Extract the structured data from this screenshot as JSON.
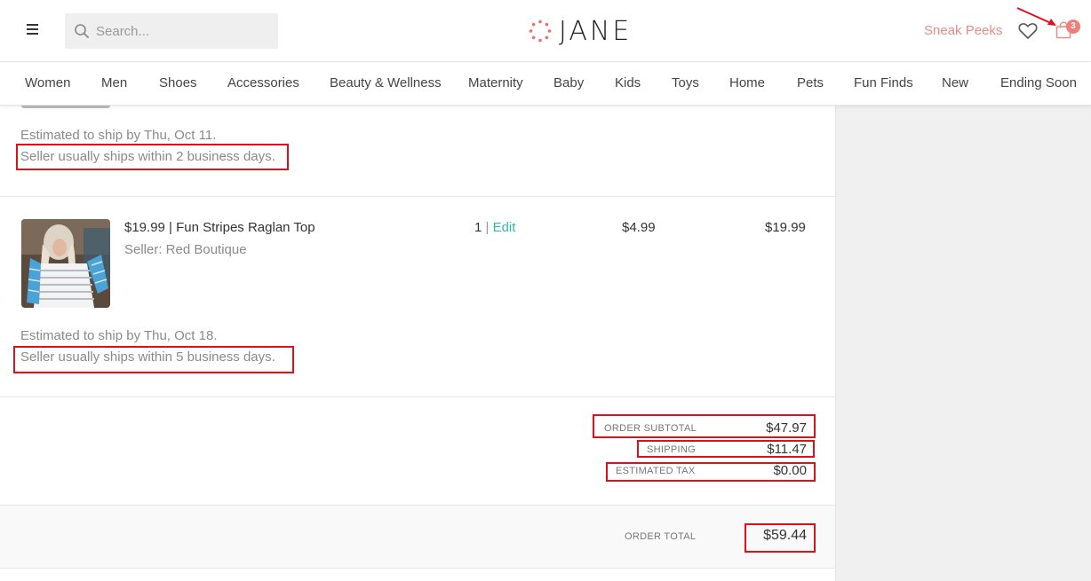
{
  "header": {
    "search_placeholder": "Search...",
    "logo_text": "JANE",
    "sneak_peeks": "Sneak Peeks",
    "cart_count": "3",
    "accent_color": "#ec8a85"
  },
  "nav": {
    "items": [
      "Women",
      "Men",
      "Shoes",
      "Accessories",
      "Beauty & Wellness",
      "Maternity",
      "Baby",
      "Kids",
      "Toys",
      "Home",
      "Pets",
      "Fun Finds",
      "New",
      "Ending Soon"
    ]
  },
  "items": [
    {
      "est_ship": "Estimated to ship by Thu, Oct 11.",
      "seller_ships": "Seller usually ships within 2 business days."
    },
    {
      "name": "$19.99 | Fun Stripes Raglan Top",
      "seller": "Seller: Red Boutique",
      "qty": "1",
      "qty_sep": " | ",
      "edit": "Edit",
      "shipping": "$4.99",
      "total": "$19.99",
      "est_ship": "Estimated to ship by Thu, Oct 18.",
      "seller_ships": "Seller usually ships within 5 business days."
    }
  ],
  "summary": {
    "subtotal_label": "ORDER SUBTOTAL",
    "subtotal": "$47.97",
    "shipping_label": "SHIPPING",
    "shipping": "$11.47",
    "tax_label": "ESTIMATED TAX",
    "tax": "$0.00",
    "total_label": "ORDER TOTAL",
    "total": "$59.44"
  }
}
